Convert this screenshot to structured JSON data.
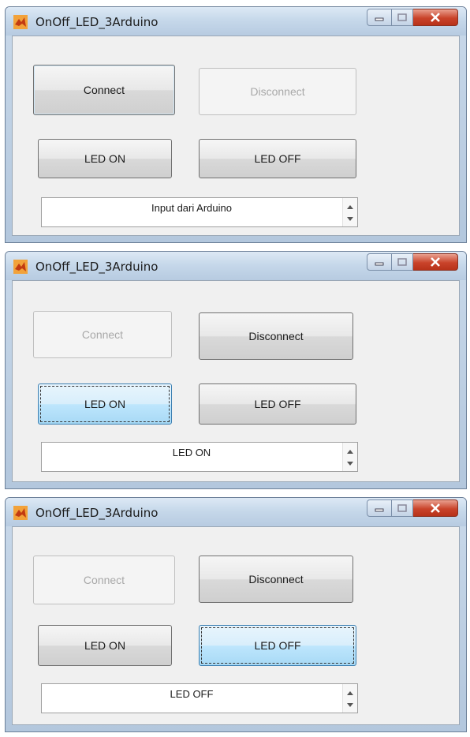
{
  "windows": [
    {
      "title": "OnOff_LED_3Arduino",
      "connect_label": "Connect",
      "disconnect_label": "Disconnect",
      "led_on_label": "LED ON",
      "led_off_label": "LED OFF",
      "listbox_value": "Input dari Arduino",
      "state": {
        "connect": "enabled",
        "disconnect": "disabled",
        "led_on": "enabled",
        "led_off": "enabled"
      }
    },
    {
      "title": "OnOff_LED_3Arduino",
      "connect_label": "Connect",
      "disconnect_label": "Disconnect",
      "led_on_label": "LED ON",
      "led_off_label": "LED OFF",
      "listbox_value": "LED ON",
      "state": {
        "connect": "disabled",
        "disconnect": "enabled",
        "led_on": "focused",
        "led_off": "enabled"
      }
    },
    {
      "title": "OnOff_LED_3Arduino",
      "connect_label": "Connect",
      "disconnect_label": "Disconnect",
      "led_on_label": "LED ON",
      "led_off_label": "LED OFF",
      "listbox_value": "LED OFF",
      "state": {
        "connect": "disabled",
        "disconnect": "enabled",
        "led_on": "enabled",
        "led_off": "focused"
      }
    }
  ],
  "icons": {
    "app": "matlab-logo-icon",
    "minimize": "minimize-icon",
    "maximize": "maximize-icon",
    "close": "close-icon",
    "scroll_up": "scroll-up-arrow-icon",
    "scroll_down": "scroll-down-arrow-icon"
  },
  "colors": {
    "focused_button": "#bee6fd",
    "close_button": "#c9432a",
    "window_frame": "#b7cbe1"
  }
}
